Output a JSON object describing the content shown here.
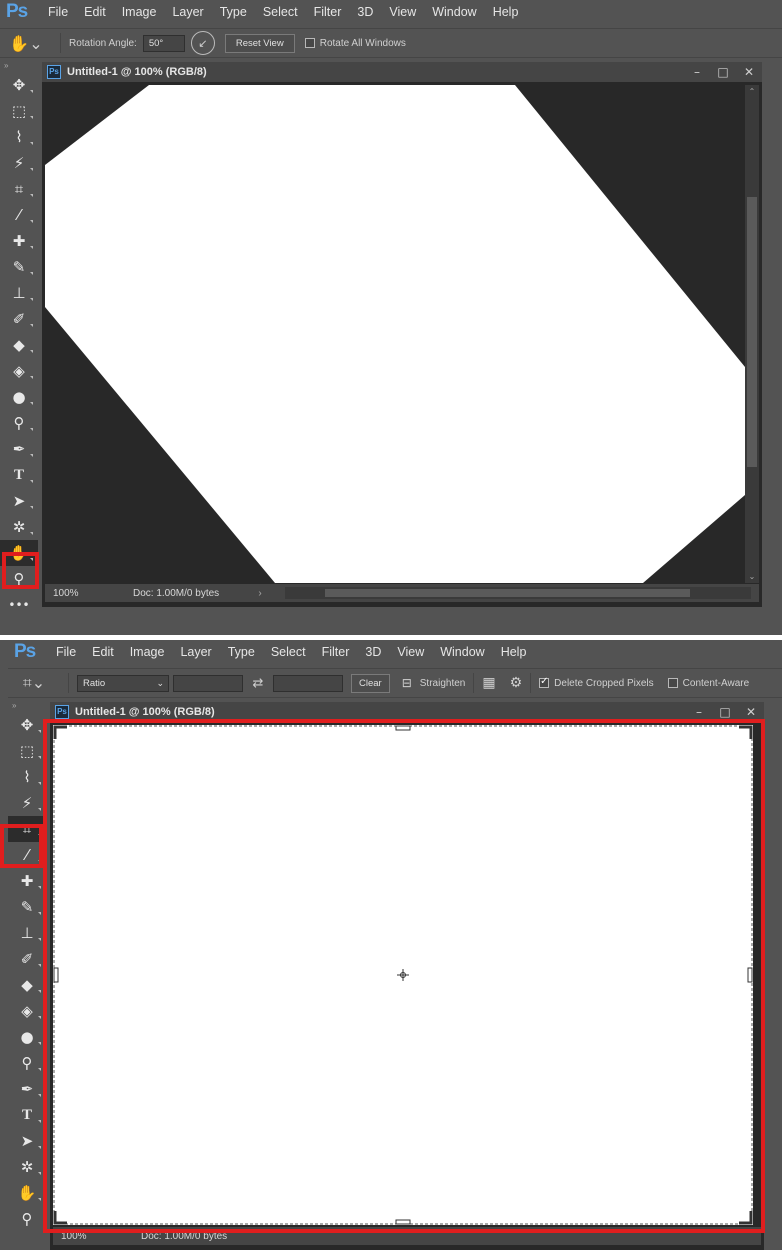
{
  "app": {
    "logo": "Ps"
  },
  "menu": [
    "File",
    "Edit",
    "Image",
    "Layer",
    "Type",
    "Select",
    "Filter",
    "3D",
    "View",
    "Window",
    "Help"
  ],
  "rotate_options": {
    "rotation_label": "Rotation Angle:",
    "rotation_value": "50°",
    "reset_label": "Reset View",
    "rotate_all_label": "Rotate All Windows"
  },
  "crop_options": {
    "ratio_value": "Ratio",
    "width_value": "",
    "height_value": "",
    "clear_label": "Clear",
    "straighten_label": "Straighten",
    "delete_cropped_label": "Delete Cropped Pixels",
    "delete_cropped_checked": true,
    "content_aware_label": "Content-Aware"
  },
  "document": {
    "title": "Untitled-1 @ 100% (RGB/8)",
    "zoom": "100%",
    "doc_info": "Doc: 1.00M/0 bytes"
  },
  "tools": [
    "move-tool",
    "marquee-tool",
    "lasso-tool",
    "magic-wand-tool",
    "crop-tool",
    "eyedropper-tool",
    "healing-brush-tool",
    "brush-tool",
    "clone-stamp-tool",
    "history-brush-tool",
    "eraser-tool",
    "paint-bucket-tool",
    "blur-tool",
    "dodge-tool",
    "pen-tool",
    "type-tool",
    "path-selection-tool",
    "shape-tool",
    "rotate-view-tool",
    "zoom-tool",
    "more-tools"
  ],
  "colors": {
    "highlight": "#e01e1e",
    "ps_blue": "#5aa3e6",
    "canvas_bg": "#282828",
    "ui_bg": "#535353"
  }
}
